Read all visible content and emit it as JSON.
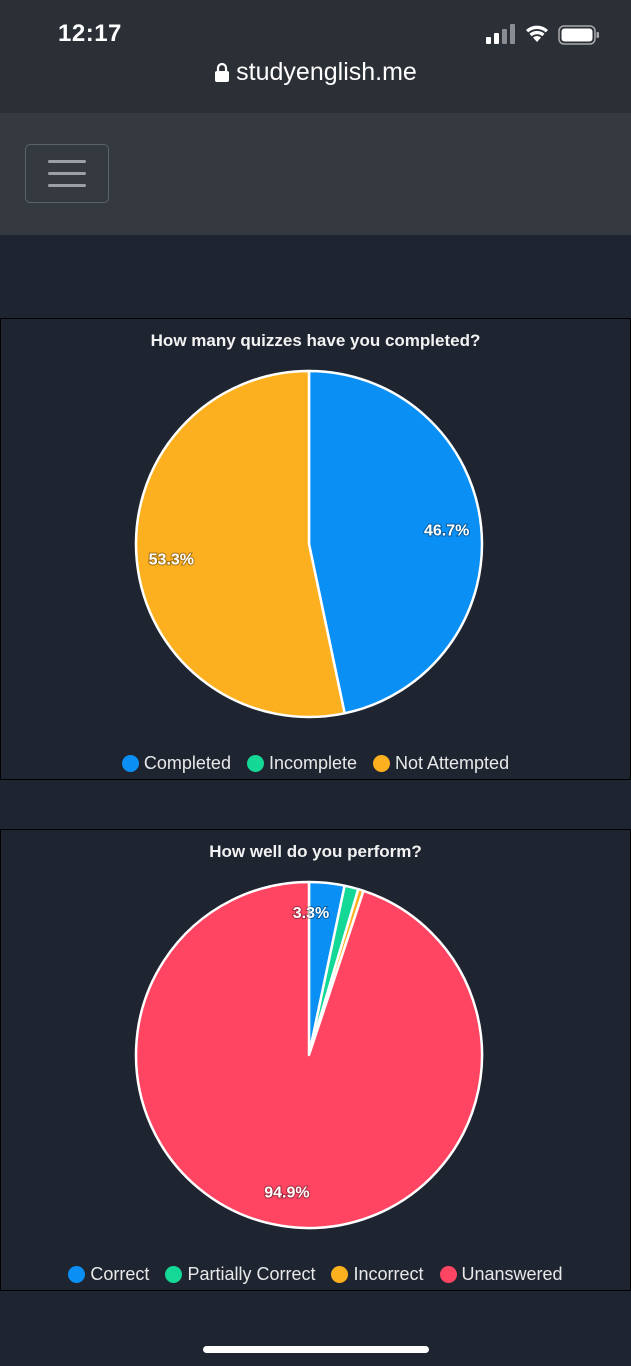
{
  "status_bar": {
    "time": "12:17"
  },
  "browser": {
    "url": "studyenglish.me"
  },
  "navbar": {
    "menu_icon": "hamburger-menu-icon"
  },
  "chart_data": [
    {
      "type": "pie",
      "title": "How many quizzes have you completed?",
      "categories": [
        "Completed",
        "Incomplete",
        "Not Attempted"
      ],
      "values": [
        46.7,
        0,
        53.3
      ],
      "labels": [
        "46.7%",
        "",
        "53.3%"
      ],
      "colors": [
        "#0a8ff5",
        "#14d896",
        "#fdb01f"
      ],
      "legend_position": "bottom"
    },
    {
      "type": "pie",
      "title": "How well do you perform?",
      "categories": [
        "Correct",
        "Partially Correct",
        "Incorrect",
        "Unanswered"
      ],
      "values": [
        3.3,
        1.3,
        0.5,
        94.9
      ],
      "labels": [
        "3.3%",
        "",
        "",
        "94.9%"
      ],
      "colors": [
        "#0a8ff5",
        "#14d896",
        "#fdb01f",
        "#ff4561"
      ],
      "legend_position": "bottom"
    }
  ]
}
